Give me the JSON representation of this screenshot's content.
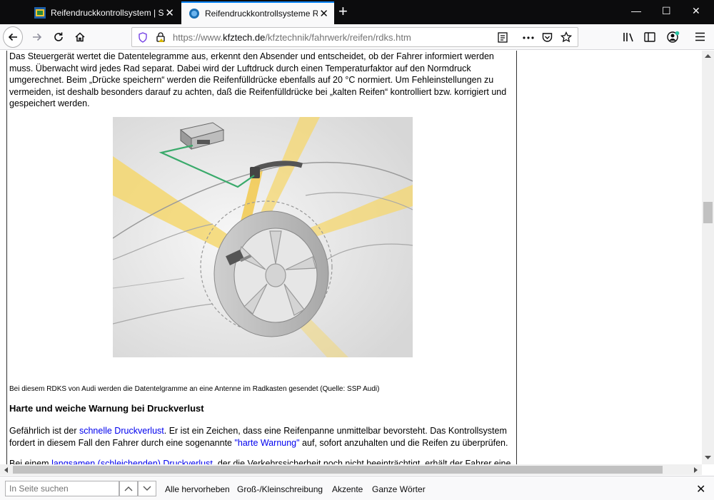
{
  "tabs": [
    {
      "title": "Reifendruckkontrollsystem | Se",
      "active": false
    },
    {
      "title": "Reifendruckkontrollsysteme RD",
      "active": true
    }
  ],
  "window_controls": {
    "minimize": "—",
    "maximize": "☐",
    "close": "✕"
  },
  "urlbar": {
    "prefix": "https://www.",
    "host": "kfztech.de",
    "path": "/kfztechnik/fahrwerk/reifen/rdks.htm"
  },
  "article": {
    "intro": "Das Steuergerät wertet die Datentelegramme aus, erkennt den Absender und entscheidet, ob der Fahrer informiert werden muss. Überwacht wird jedes Rad separat. Dabei wird der Luftdruck durch einen Temperaturfaktor auf den Normdruck umgerechnet. Beim „Drücke speichern“ werden die Reifenfülldrücke ebenfalls auf 20 °C normiert. Um Fehleinstellungen zu vermeiden, ist deshalb besonders darauf zu achten, daß die Reifenfülldrücke bei „kalten Reifen“ kontrolliert bzw. korrigiert und gespeichert werden.",
    "caption": "Bei diesem RDKS von Audi werden die Datentelgramme an eine Antenne im Radkasten gesendet (Quelle: SSP Audi)",
    "heading": "Harte und weiche Warnung bei Druckverlust",
    "p2_a": "Gefährlich ist der ",
    "p2_link1": "schnelle Druckverlust",
    "p2_b": ". Er ist ein Zeichen, dass eine Reifenpanne unmittelbar bevorsteht. Das Kontrollsystem fordert in diesem Fall den Fahrer durch eine sogenannte ",
    "p2_link2": "\"harte Warnung\"",
    "p2_c": " auf, sofort anzuhalten und die Reifen zu überprüfen.",
    "p3_a": "Bei einem ",
    "p3_link": "langsamen (schleichenden) Druckverlust",
    "p3_b": ", der die Verkehrssicherheit noch nicht beeinträchtigt, erhält der Fahrer eine"
  },
  "findbar": {
    "placeholder": "In Seite suchen",
    "highlight_all": "Alle hervorheben",
    "match_case": "Groß-/Kleinschreibung",
    "match_diacritics": "Akzente",
    "whole_words": "Ganze Wörter"
  },
  "colors": {
    "accent": "#0a84ff",
    "link": "#0000ee",
    "titlebar": "#0c0c0d",
    "ray": "#f5d76e",
    "wire": "#3aaa6b"
  }
}
